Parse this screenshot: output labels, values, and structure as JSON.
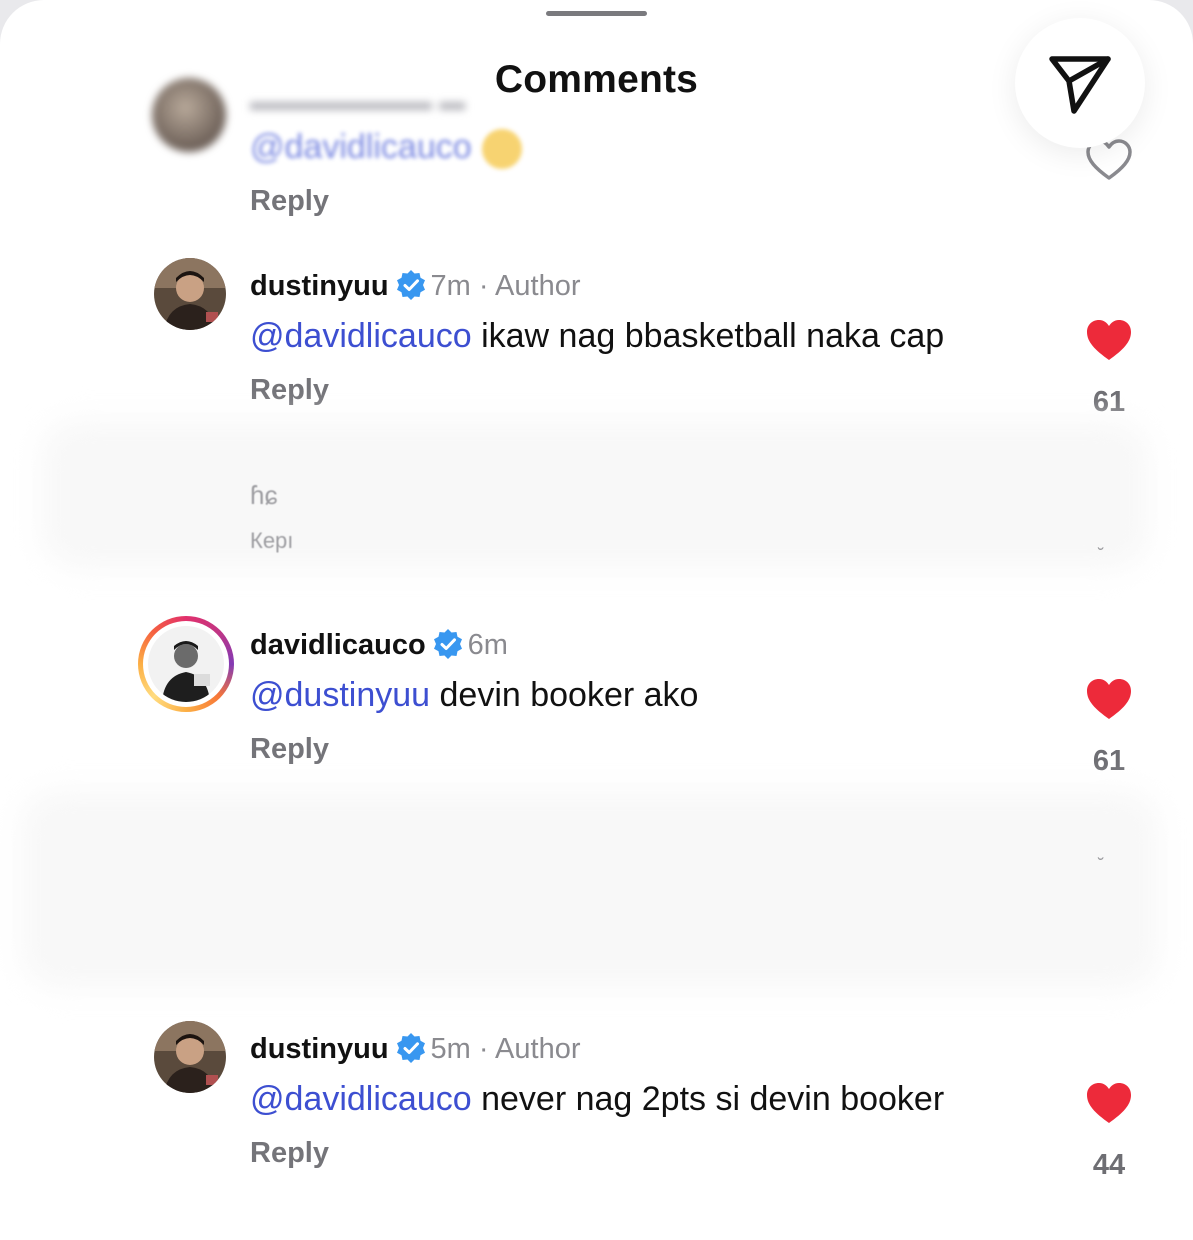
{
  "sheet": {
    "title": "Comments"
  },
  "blurred_comment": {
    "mention": "@davidlicauco",
    "reply_label": "Reply"
  },
  "comments": [
    {
      "username": "dustinyuu",
      "time": "7m",
      "separator": "·",
      "role": "Author",
      "mention": "@davidlicauco",
      "body": "ikaw nag bbasketball naka cap",
      "reply_label": "Reply",
      "likes": "61"
    },
    {
      "username": "davidlicauco",
      "time": "6m",
      "mention": "@dustinyuu",
      "body": "devin booker ako",
      "reply_label": "Reply",
      "likes": "61"
    },
    {
      "username": "dustinyuu",
      "time": "5m",
      "separator": "·",
      "role": "Author",
      "mention": "@davidlicauco",
      "body": "never nag 2pts si devin booker",
      "reply_label": "Reply",
      "likes": "44"
    }
  ],
  "ghost_texts": {
    "first": "ɦɕ",
    "second": "Керı"
  },
  "colors": {
    "mention": "#3d4fd1",
    "heart": "#ed2a3a",
    "verified": "#3897f0",
    "reply": "#747479"
  },
  "icons": {
    "share": "paper-plane-icon",
    "like": "heart-icon",
    "verified": "verified-badge-icon"
  }
}
